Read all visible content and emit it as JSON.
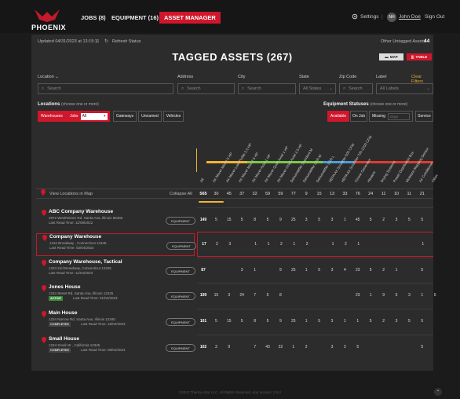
{
  "brand": {
    "name": "PHOENIX"
  },
  "nav": {
    "jobs": "JOBS (8)",
    "equipment": "EQUIPMENT (16)",
    "asset_manager": "ASSET MANAGER"
  },
  "header": {
    "settings": "Settings",
    "avatar": "NH",
    "user": "John Doe",
    "signout": "Sign Out",
    "settings_icon": "gear-icon"
  },
  "status": {
    "updated": "Updated 04/31/2023 at 13:15:11",
    "refresh": "Refresh Status",
    "untagged_label": "Other Untagged Assets:",
    "untagged_count": "44"
  },
  "title": "TAGGED ASSETS (267)",
  "view": {
    "map": "MAP",
    "table": "TABLE"
  },
  "filters": {
    "location": "Location",
    "address": "Address",
    "city": "City",
    "state": "State",
    "zip": "Zip Code",
    "label": "Label",
    "clear": "Clear Filters",
    "search_ph": "Search",
    "state_ph": "All States",
    "label_ph": "All Labels"
  },
  "locations": {
    "heading": "Locations",
    "hint": "(choose one or more)",
    "warehouses": "Warehouses",
    "jobs": "Jobs",
    "jobs_select": "All",
    "gateways": "Gateways",
    "unnamed": "Unnamed",
    "vehicles": "Vehicles"
  },
  "statuses": {
    "heading": "Equipment Statuses",
    "hint": "(choose one or more)",
    "available": "Available",
    "on_job": "On Job",
    "missing": "Missing",
    "days_ph": "Days",
    "service": "Service"
  },
  "columns": [
    "All",
    "Air Mover Mini 2.5 HP",
    "Air Mover Low Profile 2.5 HP",
    "Air Mover Max 2.5 HP",
    "Air Mover Axial 1 HP",
    "Air Mover Quiet Axial 1 HP",
    "Air Mover Chief Axial 2.5 HP",
    "Dehumidifier Standard M",
    "Dehumidifier LGR M",
    "Dehumidifier LGR L",
    "HEPA Air Scrubber 600 CFM",
    "HEPA Air Scrubber 700-1200 CFM",
    "Ozone Generator",
    "Heaters",
    "Drying Systems",
    "Power Distribution Box",
    "Moisture Mapping Sensor",
    "Air Conditioner",
    "Other"
  ],
  "map_link": "View Locations in Map",
  "collapse": "Collapse All",
  "totals": [
    "565",
    "30",
    "45",
    "37",
    "32",
    "59",
    "59",
    "77",
    "9",
    "15",
    "13",
    "33",
    "76",
    "24",
    "11",
    "10",
    "11",
    "21"
  ],
  "rows": [
    {
      "name": "ABC Company Warehouse",
      "addr": "2972 Westheimer Rd. Santa Ana, Illinois 85486",
      "read": "Last Read Time: 11/08/2022",
      "badge": "",
      "cells": [
        "149",
        "5",
        "15",
        "5",
        "8",
        "5",
        "9",
        "25",
        "3",
        "5",
        "3",
        "1",
        "45",
        "5",
        "2",
        "3",
        "5",
        "5"
      ]
    },
    {
      "name": "Company Warehouse",
      "addr": "1234 Broadway , Connecticut 12345",
      "read": "Last Read Time: 03/04/2023",
      "badge": "",
      "cells": [
        "17",
        "2",
        "3",
        "",
        "1",
        "1",
        "2",
        "1",
        "2",
        "",
        "1",
        "2",
        "1",
        "",
        "",
        "",
        "",
        "1"
      ]
    },
    {
      "name": "Company Warehouse, Tactical",
      "addr": "1234 2nd Broadway, Connecticut 12345",
      "read": "Last Read Time: 11/04/2023",
      "badge": "",
      "cells": [
        "87",
        "",
        "",
        "3",
        "1",
        "",
        "9",
        "25",
        "1",
        "5",
        "3",
        "4",
        "23",
        "5",
        "2",
        "1",
        "",
        "5"
      ]
    },
    {
      "name": "Jones House",
      "addr": "1234 Street Rd. Santa Ana, Illinois 12345",
      "read": "Last Read Time: 01/04/2023",
      "badge": "ACTIVE",
      "cells": [
        "109",
        "15",
        "3",
        "24",
        "7",
        "5",
        "8",
        "",
        "",
        "",
        "",
        "",
        "23",
        "1",
        "9",
        "5",
        "3",
        "1",
        "5"
      ]
    },
    {
      "name": "Main House",
      "addr": "1234 Narrow Rd. Santa Ana, Illinois 12345",
      "read": "Last Read Time: 15/04/2023",
      "badge": "COMPLETED",
      "cells": [
        "101",
        "5",
        "15",
        "5",
        "8",
        "5",
        "9",
        "25",
        "1",
        "5",
        "3",
        "1",
        "1",
        "5",
        "2",
        "3",
        "5",
        "5"
      ]
    },
    {
      "name": "Small House",
      "addr": "1234 Small str , California 12345",
      "read": "Last Read Time: 08/04/2024",
      "badge": "COMPLETED",
      "cells": [
        "102",
        "3",
        "9",
        "",
        "7",
        "43",
        "22",
        "1",
        "2",
        "",
        "3",
        "2",
        "5",
        "",
        "",
        "",
        "",
        "5"
      ]
    }
  ],
  "equipment_btn": "EQUIPMENT",
  "footer": "©2022 Thermo-Stor LLC. All Rights Reserved. App Version: 2.9.0",
  "colors": {
    "accent": "#d0162b",
    "stripe": [
      "#f2b632",
      "#7ac943",
      "#4a9fd8",
      "#e03c31"
    ]
  }
}
